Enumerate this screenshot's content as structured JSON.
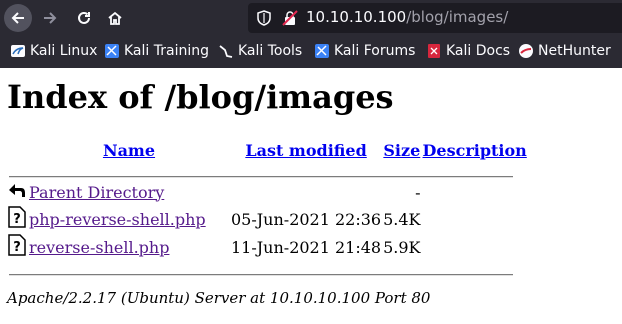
{
  "browser": {
    "url_host": "10.10.10.100",
    "url_path": "/blog/images/",
    "bookmarks": [
      {
        "label": "Kali Linux",
        "icon": "kali-dragon-icon"
      },
      {
        "label": "Kali Training",
        "icon": "kali-training-icon"
      },
      {
        "label": "Kali Tools",
        "icon": "kali-tools-icon"
      },
      {
        "label": "Kali Forums",
        "icon": "kali-forums-icon"
      },
      {
        "label": "Kali Docs",
        "icon": "kali-docs-icon"
      },
      {
        "label": "NetHunter",
        "icon": "nethunter-icon"
      }
    ]
  },
  "page": {
    "title": "Index of /blog/images",
    "columns": {
      "name": "Name",
      "last_modified": "Last modified",
      "size": "Size",
      "description": "Description"
    },
    "rows": [
      {
        "name": "Parent Directory",
        "modified": "",
        "size": "-",
        "icon": "back-folder-icon"
      },
      {
        "name": "php-reverse-shell.php",
        "modified": "05-Jun-2021 22:36",
        "size": "5.4K",
        "icon": "unknown-file-icon"
      },
      {
        "name": "reverse-shell.php",
        "modified": "11-Jun-2021 21:48",
        "size": "5.9K",
        "icon": "unknown-file-icon"
      }
    ],
    "address": "Apache/2.2.17 (Ubuntu) Server at 10.10.10.100 Port 80"
  }
}
